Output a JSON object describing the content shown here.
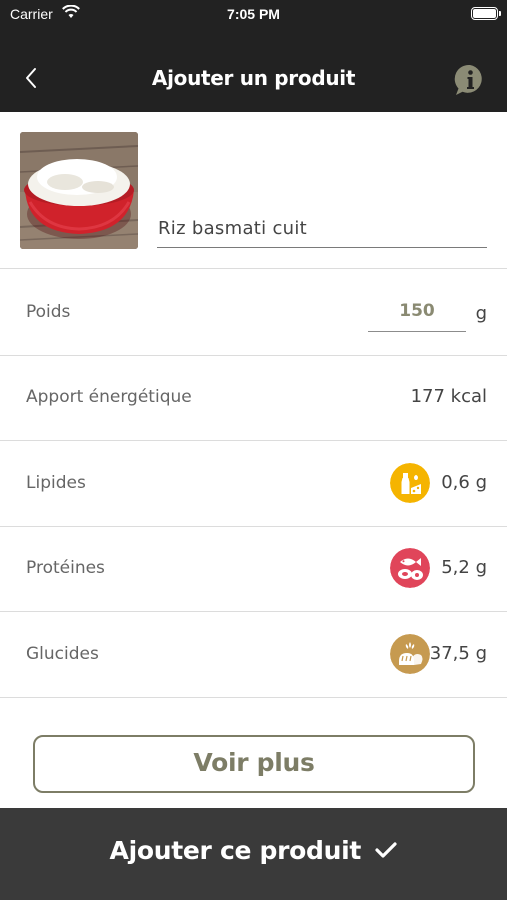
{
  "status_bar": {
    "carrier": "Carrier",
    "time": "7:05 PM"
  },
  "nav": {
    "title": "Ajouter un produit",
    "back_icon": "chevron-left-icon",
    "info_icon": "info-icon"
  },
  "product": {
    "name": "Riz basmati cuit",
    "image": "rice-bowl-photo"
  },
  "weight": {
    "label": "Poids",
    "value": "150",
    "unit": "g"
  },
  "energy": {
    "label": "Apport énergétique",
    "value": "177 kcal"
  },
  "lipids": {
    "label": "Lipides",
    "value": "0,6 g",
    "icon": "oil-cheese-icon",
    "color": "#f5b400"
  },
  "proteins": {
    "label": "Protéines",
    "value": "5,2 g",
    "icon": "fish-meat-icon",
    "color": "#e0455a"
  },
  "carbs": {
    "label": "Glucides",
    "value": "37,5 g",
    "icon": "bread-icon",
    "color": "#c69a50"
  },
  "buttons": {
    "more": "Voir plus",
    "add": "Ajouter ce produit"
  },
  "colors": {
    "header_bg": "#222222",
    "accent_olive": "#7d7d66",
    "footer_bg": "#3a3a3a"
  }
}
